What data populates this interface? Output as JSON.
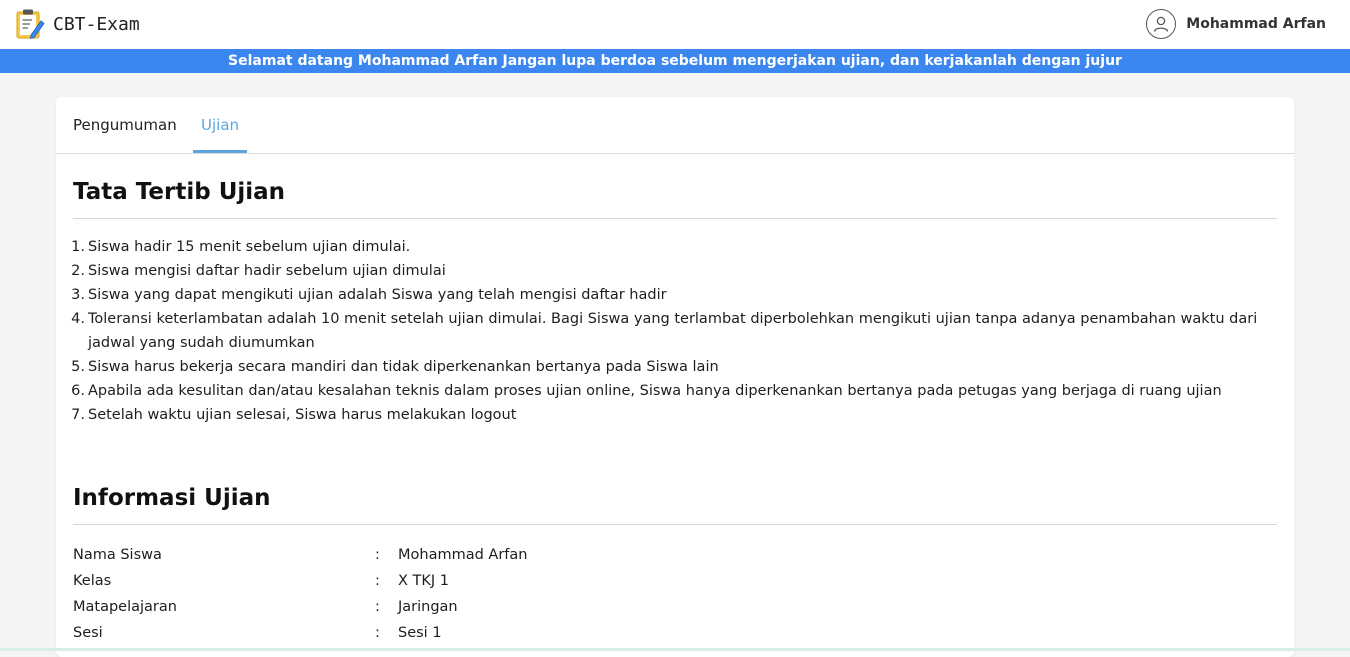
{
  "app": {
    "brand_name": "CBT-Exam",
    "user_name": "Mohammad Arfan",
    "accent_color": "#3b87ef",
    "tab_accent_color": "#5aa5dc"
  },
  "banner": {
    "text": "Selamat datang Mohammad Arfan Jangan lupa berdoa sebelum mengerjakan ujian, dan kerjakanlah dengan jujur"
  },
  "tabs": [
    {
      "label": "Pengumuman",
      "active": false
    },
    {
      "label": "Ujian",
      "active": true
    }
  ],
  "rules_section": {
    "title": "Tata Tertib Ujian",
    "items": [
      {
        "num": "1.",
        "text": "Siswa hadir 15 menit sebelum ujian dimulai."
      },
      {
        "num": "2.",
        "text": "Siswa mengisi daftar hadir sebelum ujian dimulai"
      },
      {
        "num": "3.",
        "text": "Siswa yang dapat mengikuti ujian adalah Siswa yang telah mengisi daftar hadir"
      },
      {
        "num": "4.",
        "text": "Toleransi keterlambatan adalah 10 menit setelah ujian dimulai. Bagi Siswa yang terlambat diperbolehkan mengikuti ujian tanpa adanya penambahan waktu dari jadwal yang sudah diumumkan"
      },
      {
        "num": "5.",
        "text": "Siswa harus bekerja secara mandiri dan tidak diperkenankan bertanya pada Siswa lain"
      },
      {
        "num": "6.",
        "text": "Apabila ada kesulitan dan/atau kesalahan teknis dalam proses ujian online, Siswa hanya diperkenankan bertanya pada petugas yang berjaga di ruang ujian"
      },
      {
        "num": "7.",
        "text": "Setelah waktu ujian selesai, Siswa harus melakukan logout"
      }
    ]
  },
  "info_section": {
    "title": "Informasi Ujian",
    "separator": ":",
    "rows": [
      {
        "label": "Nama Siswa",
        "value": "Mohammad Arfan"
      },
      {
        "label": "Kelas",
        "value": "X TKJ 1"
      },
      {
        "label": "Matapelajaran",
        "value": "Jaringan"
      },
      {
        "label": "Sesi",
        "value": "Sesi 1"
      }
    ]
  },
  "icons": {
    "brand": "clipboard-pencil-icon",
    "user": "user-avatar-icon"
  }
}
